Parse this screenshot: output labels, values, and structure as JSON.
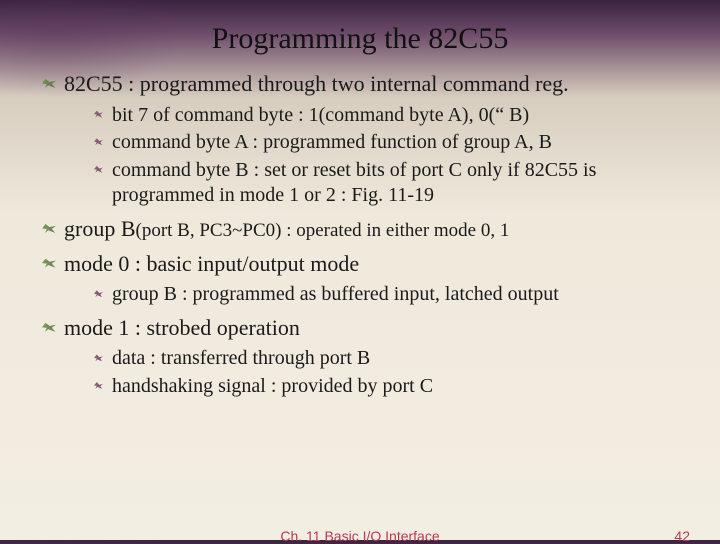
{
  "title": "Programming the 82C55",
  "top": [
    {
      "text": "82C55 : programmed through two internal command reg.",
      "sub": [
        "bit 7 of command byte : 1(command byte A), 0(“ B)",
        "command byte A : programmed function of group A, B",
        "command byte B : set or reset bits of port C only if 82C55 is programmed in mode 1 or 2   : Fig. 11-19"
      ]
    },
    {
      "lead": "group B",
      "suffix": "(port B, PC3~PC0) : operated in either mode 0, 1"
    },
    {
      "text": "mode 0 : basic input/output mode",
      "sub": [
        "group B : programmed as buffered input, latched output"
      ]
    },
    {
      "text": "mode 1 : strobed operation",
      "sub": [
        "data : transferred through port B",
        "handshaking signal : provided by port C"
      ]
    }
  ],
  "footer": {
    "chapter": "Ch. 11 Basic I/O Interface",
    "page": "42"
  }
}
